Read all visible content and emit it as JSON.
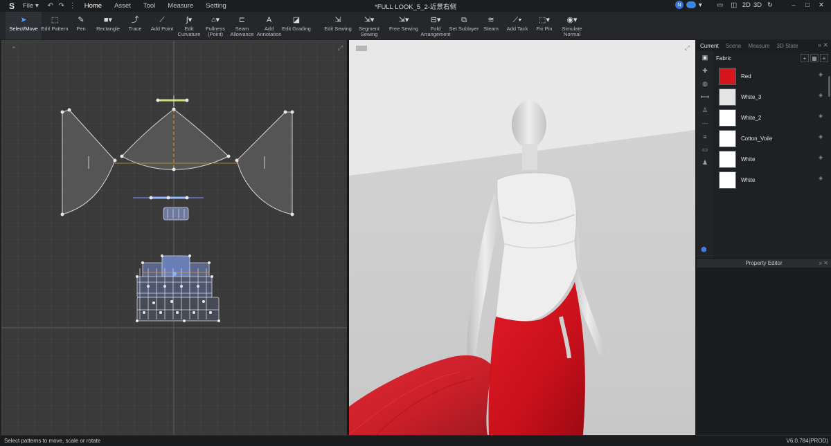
{
  "title": "*FULL LOOK_5_2-近景右侧",
  "menu": {
    "file": "File",
    "items": [
      "Home",
      "Asset",
      "Tool",
      "Measure",
      "Setting"
    ]
  },
  "titlebar_right": {
    "user_initial": "N",
    "mode_2d": "2D",
    "mode_3d": "3D"
  },
  "toolbar": {
    "tools": [
      {
        "label": "Select/Move",
        "icon": "cursor-icon"
      },
      {
        "label": "Edit Pattern",
        "icon": "edit-pattern-icon"
      },
      {
        "label": "Pen",
        "icon": "pen-icon"
      },
      {
        "label": "Rectangle",
        "icon": "rectangle-icon"
      },
      {
        "label": "Trace",
        "icon": "trace-icon"
      },
      {
        "label": "Add Point",
        "icon": "add-point-icon"
      },
      {
        "label": "Edit\nCurvature",
        "icon": "curvature-icon"
      },
      {
        "label": "Fullness\n(Point)",
        "icon": "fullness-icon"
      },
      {
        "label": "Seam\nAllowance",
        "icon": "seam-icon"
      },
      {
        "label": "Add\nAnnotation",
        "icon": "annotation-icon"
      },
      {
        "label": "Edit Grading",
        "icon": "grading-icon"
      },
      {
        "label": "Edit Sewing",
        "icon": "edit-sewing-icon"
      },
      {
        "label": "Segment\nSewing",
        "icon": "segment-sewing-icon"
      },
      {
        "label": "Free Sewing",
        "icon": "free-sewing-icon"
      },
      {
        "label": "Fold\nArrangement",
        "icon": "fold-icon"
      },
      {
        "label": "Set Sublayer",
        "icon": "sublayer-icon"
      },
      {
        "label": "Steam",
        "icon": "steam-icon"
      },
      {
        "label": "Add Tack",
        "icon": "tack-icon"
      },
      {
        "label": "Fix Pin",
        "icon": "pin-icon"
      },
      {
        "label": "Simulate\nNormal",
        "icon": "simulate-icon"
      }
    ]
  },
  "panel": {
    "tabs": [
      "Current",
      "Scene",
      "Measure",
      "3D State"
    ],
    "library_title": "Fabric",
    "fabrics": [
      {
        "name": "Red",
        "color": "#d8141e"
      },
      {
        "name": "White_3",
        "color": "#e4e4e4"
      },
      {
        "name": "White_2",
        "color": "#ffffff"
      },
      {
        "name": "Cotton_Voile",
        "color": "#ffffff"
      },
      {
        "name": "White",
        "color": "#ffffff"
      },
      {
        "name": "White",
        "color": "#ffffff"
      }
    ],
    "property_editor": "Property Editor"
  },
  "status": {
    "message": "Select patterns to move, scale or rotate",
    "version": "V6.0.784(PROD)"
  },
  "colors": {
    "accent": "#5aa0ff",
    "fabric_red": "#d8141e",
    "viewport_2d": "#3a3a3b",
    "viewport_3d": "#dcdcdc"
  }
}
